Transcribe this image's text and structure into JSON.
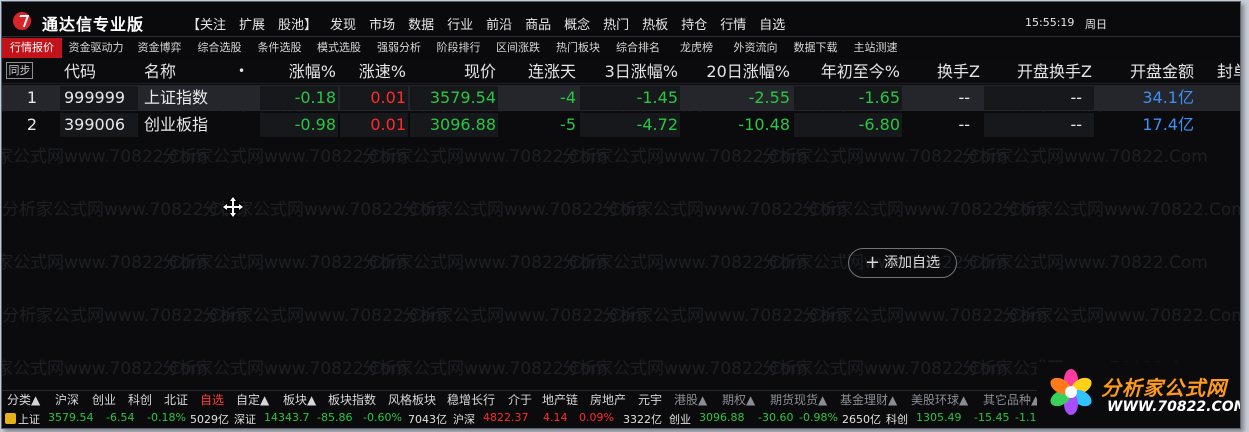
{
  "app": {
    "title": "通达信专业版",
    "top_menu": [
      "【关注",
      "扩展",
      "股池】",
      "发现",
      "市场",
      "数据",
      "行业",
      "前沿",
      "商品",
      "概念",
      "热门",
      "热板",
      "持仓",
      "行情",
      "自选"
    ],
    "time": "15:55:19",
    "weekday": "周日"
  },
  "tabs": [
    "行情报价",
    "资金驱动力",
    "资金博弈",
    "综合选股",
    "条件选股",
    "模式选股",
    "强弱分析",
    "阶段排行",
    "区间涨跌",
    "热门板块",
    "综合排名",
    "龙虎榜",
    "外资流向",
    "数据下载",
    "主站测速"
  ],
  "active_tab": "行情报价",
  "table": {
    "sync_label": "同步",
    "columns": [
      "代码",
      "名称",
      "•",
      "涨幅%",
      "涨速%",
      "现价",
      "连涨天",
      "3日涨幅%",
      "20日涨幅%",
      "年初至今%",
      "换手Z",
      "开盘换手Z",
      "开盘金额",
      "封单"
    ],
    "rows": [
      {
        "idx": "1",
        "code": "999999",
        "name": "上证指数",
        "chg": "-0.18",
        "speed": "0.01",
        "price": "3579.54",
        "days": "-4",
        "d3": "-1.45",
        "d20": "-2.55",
        "ytd": "-1.65",
        "turn": "--",
        "open_turn": "--",
        "open_amt": "34.1亿"
      },
      {
        "idx": "2",
        "code": "399006",
        "name": "创业板指",
        "chg": "-0.98",
        "speed": "0.01",
        "price": "3096.88",
        "days": "-5",
        "d3": "-4.72",
        "d20": "-10.48",
        "ytd": "-6.80",
        "turn": "--",
        "open_turn": "--",
        "open_amt": "17.4亿"
      }
    ]
  },
  "add_button": {
    "icon": "plus-icon",
    "label": "添加自选"
  },
  "watermark": {
    "cn": "分析家公式网",
    "url": "www.70822.Com"
  },
  "bottom_tabs": [
    "分类▲",
    "沪深",
    "创业",
    "科创",
    "北证",
    "自选",
    "自定▲",
    "板块▲",
    "板块指数",
    "风格板块",
    "稳增长行",
    "介于",
    "地产链",
    "房地产",
    "元宇",
    "港股▲",
    "期权▲",
    "期货现货▲",
    "基金理财▲",
    "美股环球▲",
    "其它品种▲"
  ],
  "active_bottom_tab": "自选",
  "status": [
    {
      "label": "上证",
      "price": "3579.54",
      "change": "-6.54",
      "pct": "-0.18%",
      "amount": "5029亿"
    },
    {
      "label": "深证",
      "price": "14343.7",
      "change": "-85.86",
      "pct": "-0.60%",
      "amount": "7043亿"
    },
    {
      "label": "沪深",
      "price": "4822.37",
      "change": "4.14",
      "pct": "0.09%",
      "amount": "3322亿"
    },
    {
      "label": "创业",
      "price": "3096.88",
      "change": "-30.60",
      "pct": "-0.98%",
      "amount": "2650亿"
    },
    {
      "label": "科创",
      "price": "1305.49",
      "change": "-15.45",
      "pct": "-1.1",
      "amount": ""
    }
  ],
  "brand": {
    "name": "分析家公式网",
    "url": "WWW.70822.COM"
  },
  "colors": {
    "up": "#ff2a2a",
    "down": "#29c642",
    "accent": "#c2121a",
    "amount": "#3f8ff3",
    "bg": "#0b0b0d"
  }
}
